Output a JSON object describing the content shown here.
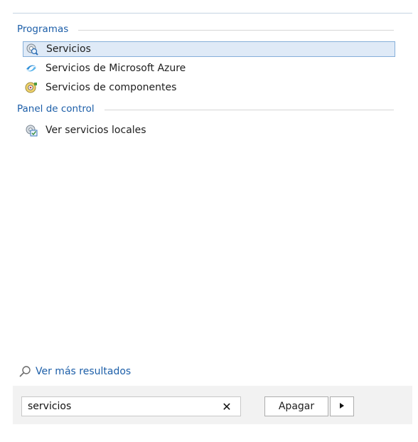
{
  "sections": {
    "programs": {
      "header": "Programas",
      "items": [
        {
          "label": "Servicios",
          "icon": "services-gear-magnifier-icon",
          "selected": true
        },
        {
          "label": "Servicios de Microsoft Azure",
          "icon": "azure-icon"
        },
        {
          "label": "Servicios de componentes",
          "icon": "component-services-icon"
        }
      ]
    },
    "control_panel": {
      "header": "Panel de control",
      "items": [
        {
          "label": "Ver servicios locales",
          "icon": "local-services-icon"
        }
      ]
    }
  },
  "more_results": {
    "label": "Ver más resultados",
    "icon": "search-icon"
  },
  "search": {
    "value": "servicios",
    "clear_icon": "close-icon"
  },
  "shutdown": {
    "label": "Apagar",
    "arrow_icon": "triangle-right-icon"
  },
  "colors": {
    "accent": "#1c5ea8",
    "selection_bg": "#dfeaf7",
    "selection_border": "#86afd9"
  }
}
